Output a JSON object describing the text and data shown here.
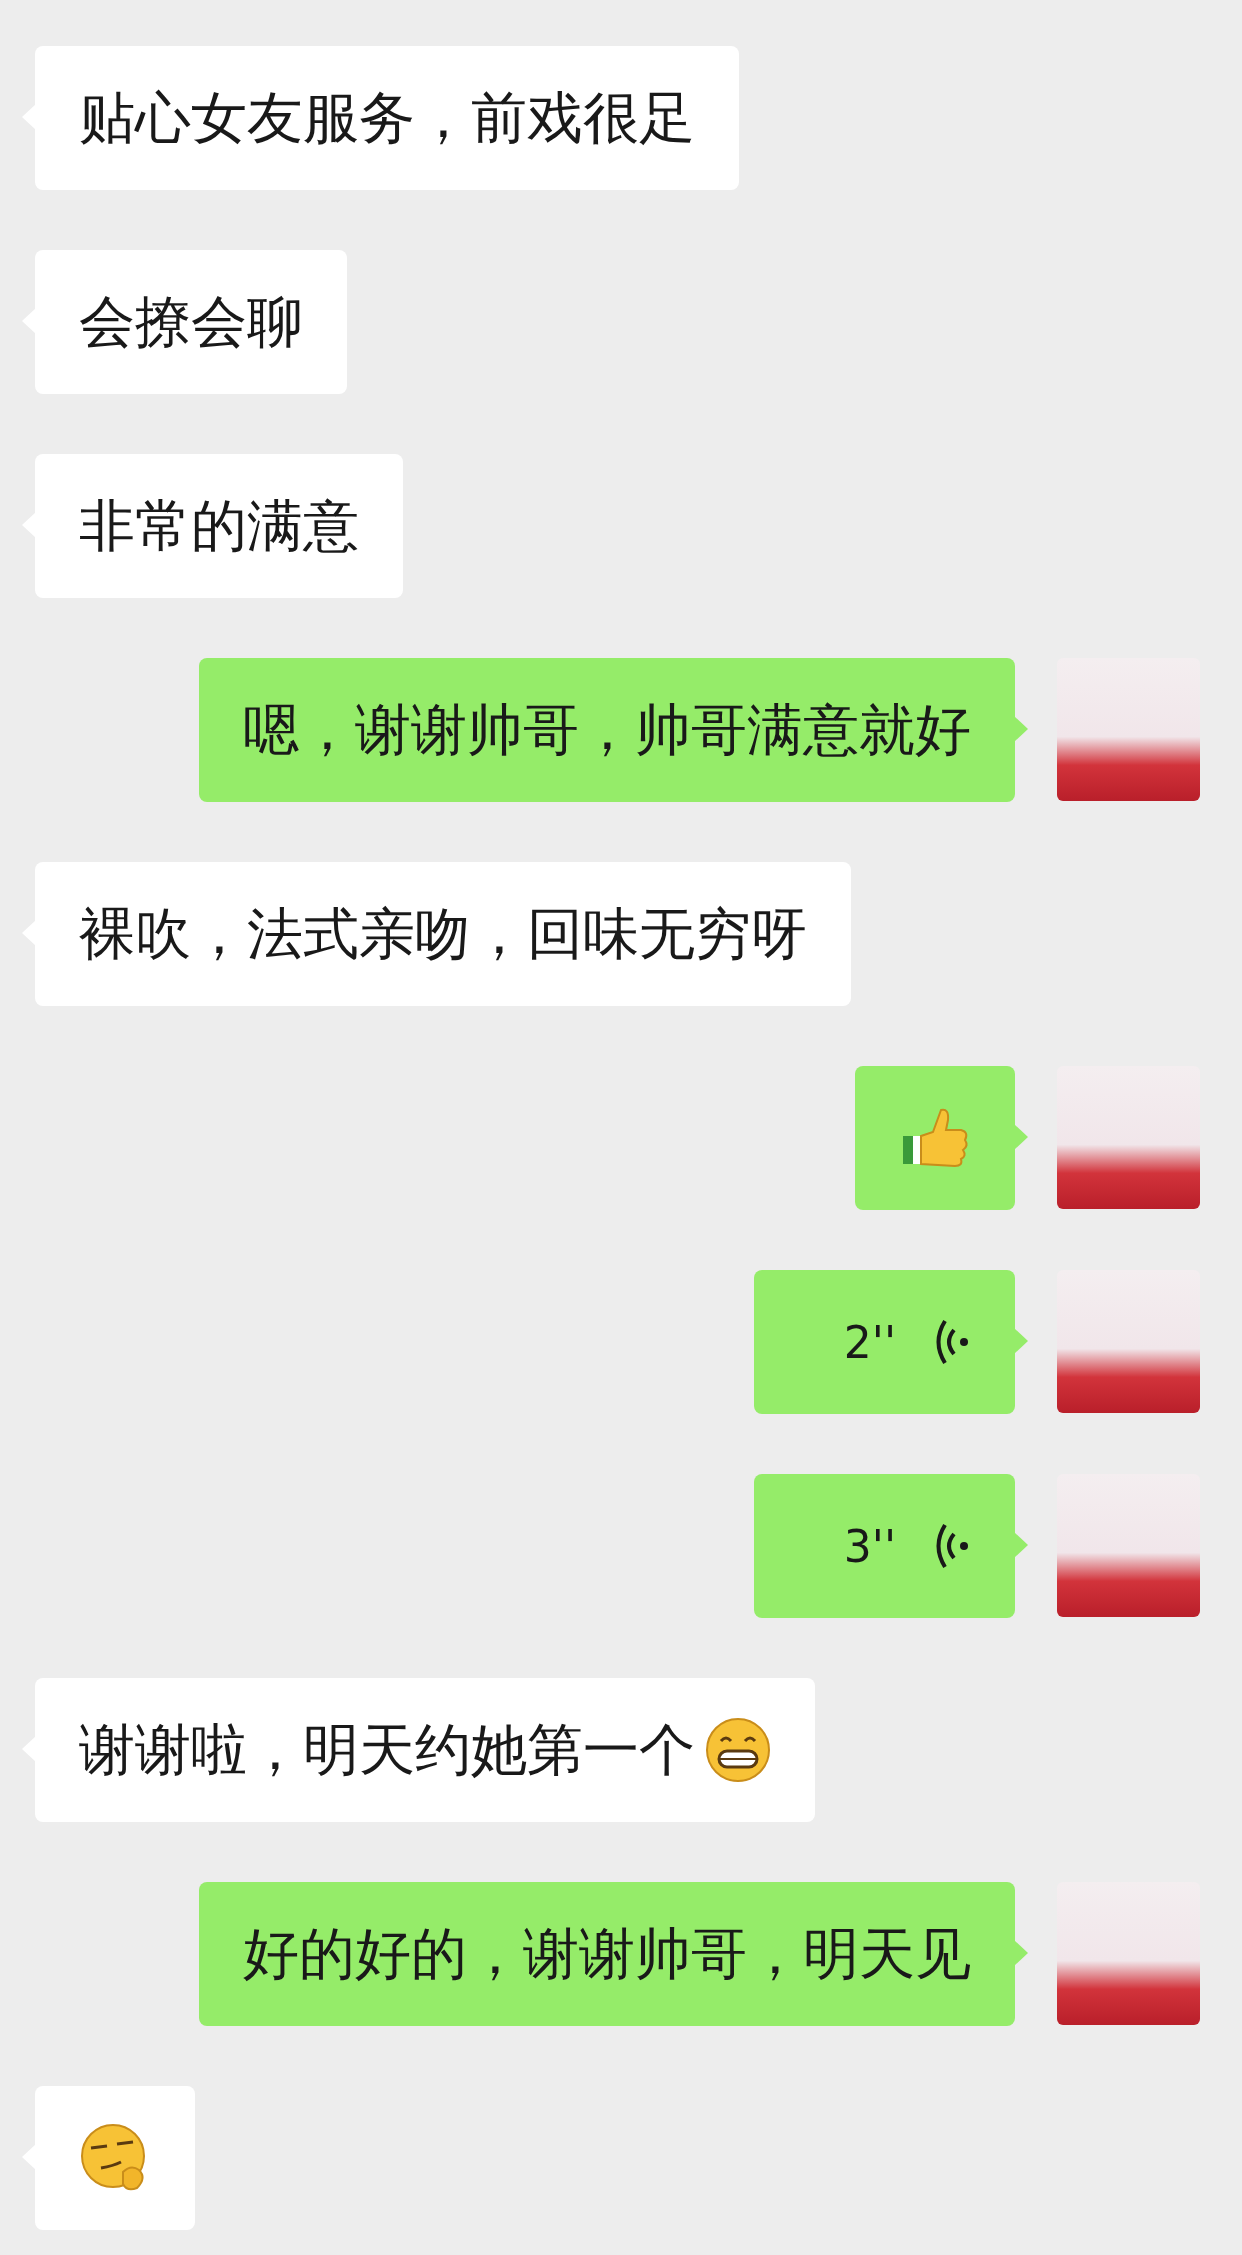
{
  "messages": [
    {
      "outgoing": false,
      "kind": "text",
      "text": "贴心女友服务，前戏很足"
    },
    {
      "outgoing": false,
      "kind": "text",
      "text": "会撩会聊"
    },
    {
      "outgoing": false,
      "kind": "text",
      "text": "非常的满意"
    },
    {
      "outgoing": true,
      "kind": "text",
      "text": "嗯，谢谢帅哥，帅哥满意就好"
    },
    {
      "outgoing": false,
      "kind": "text",
      "text": "裸吹，法式亲吻，回味无穷呀"
    },
    {
      "outgoing": true,
      "kind": "thumbsup"
    },
    {
      "outgoing": true,
      "kind": "voice",
      "duration": "2''"
    },
    {
      "outgoing": true,
      "kind": "voice",
      "duration": "3''"
    },
    {
      "outgoing": false,
      "kind": "textgrin",
      "text": "谢谢啦，明天约她第一个"
    },
    {
      "outgoing": true,
      "kind": "text",
      "text": "好的好的，谢谢帅哥，明天见"
    },
    {
      "outgoing": false,
      "kind": "smirk"
    }
  ]
}
